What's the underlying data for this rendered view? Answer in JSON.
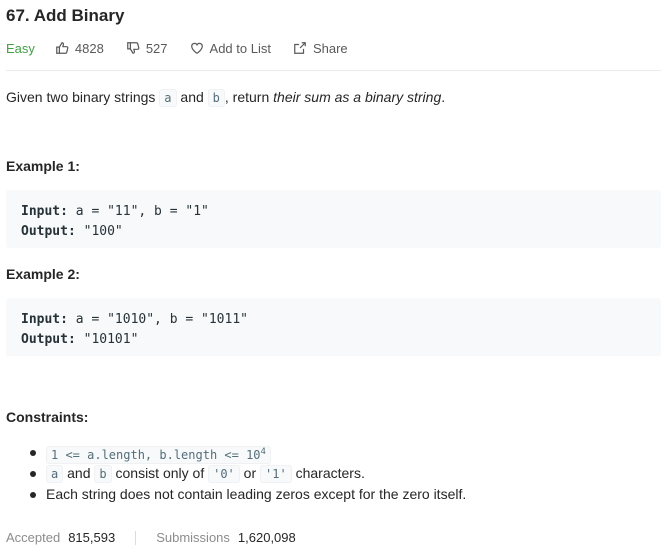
{
  "problem": {
    "title": "67. Add Binary",
    "difficulty": "Easy",
    "likes": "4828",
    "dislikes": "527",
    "add_to_list": "Add to List",
    "share": "Share",
    "colors": {
      "easy": "#43a047"
    }
  },
  "description": {
    "part1": "Given two binary strings ",
    "code_a": "a",
    "part2": " and ",
    "code_b": "b",
    "part3": ", return ",
    "emphasis": "their sum as a binary string",
    "part4": "."
  },
  "examples": [
    {
      "heading": "Example 1:",
      "input_label": "Input:",
      "input_value": " a = \"11\", b = \"1\"",
      "output_label": "Output:",
      "output_value": " \"100\""
    },
    {
      "heading": "Example 2:",
      "input_label": "Input:",
      "input_value": " a = \"1010\", b = \"1011\"",
      "output_label": "Output:",
      "output_value": " \"10101\""
    }
  ],
  "constraints": {
    "heading": "Constraints:",
    "c1_code": "1 <= a.length, b.length <= 10",
    "c1_sup": "4",
    "c2_code_a": "a",
    "c2_and": " and ",
    "c2_code_b": "b",
    "c2_mid": " consist only of ",
    "c2_code_0": "'0'",
    "c2_or": " or ",
    "c2_code_1": "'1'",
    "c2_end": " characters.",
    "c3": "Each string does not contain leading zeros except for the zero itself."
  },
  "footer": {
    "accepted_label": "Accepted",
    "accepted_value": "815,593",
    "submissions_label": "Submissions",
    "submissions_value": "1,620,098"
  }
}
